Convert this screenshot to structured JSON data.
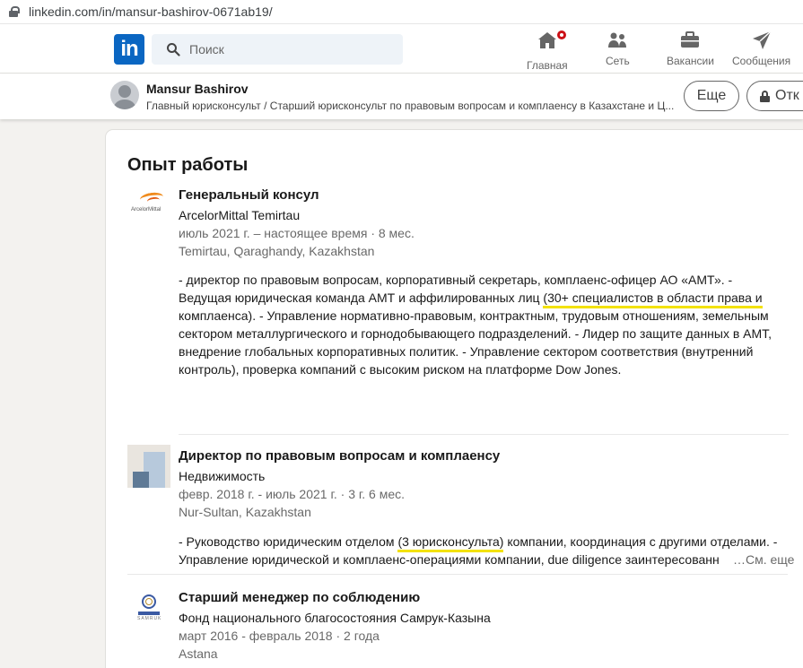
{
  "browser": {
    "url": "linkedin.com/in/mansur-bashirov-0671ab19/"
  },
  "nav": {
    "search_placeholder": "Поиск",
    "items": [
      {
        "label": "Главная",
        "icon": "home-icon"
      },
      {
        "label": "Сеть",
        "icon": "network-icon"
      },
      {
        "label": "Вакансии",
        "icon": "jobs-briefcase-icon"
      },
      {
        "label": "Сообщения",
        "icon": "messaging-icon"
      }
    ]
  },
  "profile_bar": {
    "name": "Mansur Bashirov",
    "headline": "Главный юрисконсульт / Старший юрисконсульт по правовым вопросам и комплаенсу в Казахстане и Ц...",
    "more_button": "Еще",
    "open_button": "Отк"
  },
  "experience": {
    "section_title": "Опыт работы",
    "items": [
      {
        "title": "Генеральный консул",
        "company": "ArcelorMittal Temirtau",
        "dates": "июль 2021 г. – настоящее время · 8 мес.",
        "location": "Temirtau, Qaraghandy, Kazakhstan",
        "logo_text": "ArcelorMittal",
        "desc_part1": "- директор по правовым вопросам, корпоративный секретарь, комплаенс-офицер АО «АМТ». - Ведущая юридическая команда АМТ и аффилированных лиц ",
        "desc_highlight": "(30+ специалистов в области права и",
        "desc_part2": " комплаенса). - Управление нормативно-правовым, контрактным, трудовым отношениям, земельным сектором металлургического и горнодобывающего подразделений. - Лидер по защите данных в АМТ, внедрение глобальных корпоративных политик. - Управление сектором соответствия (внутренний контроль), проверка компаний с высоким риском на платформе Dow Jones."
      },
      {
        "title": "Директор по правовым вопросам и комплаенсу",
        "company": "Недвижимость",
        "dates": "февр. 2018 г. - июль 2021 г. · 3 г. 6 мес.",
        "location": "Nur-Sultan, Kazakhstan",
        "desc_part1": "- Руководство юридическим отделом ",
        "desc_highlight": "(3 юрисконсульта)",
        "desc_part2": " компании, координация с другими отделами. - Управление юридической и комплаенс-операциями компании, due diligence заинтересованн",
        "see_more": "…См. еще"
      },
      {
        "title": "Старший менеджер по соблюдению",
        "company": "Фонд национального благосостояния Самрук-Казына",
        "dates": "март 2016 - февраль 2018 · 2 года",
        "location": "Astana",
        "logo_text": "SAMRUK"
      }
    ]
  },
  "colors": {
    "linkedin_blue": "#0a66c2",
    "highlight_yellow": "#f3e200",
    "notification_red": "#cc1016"
  }
}
